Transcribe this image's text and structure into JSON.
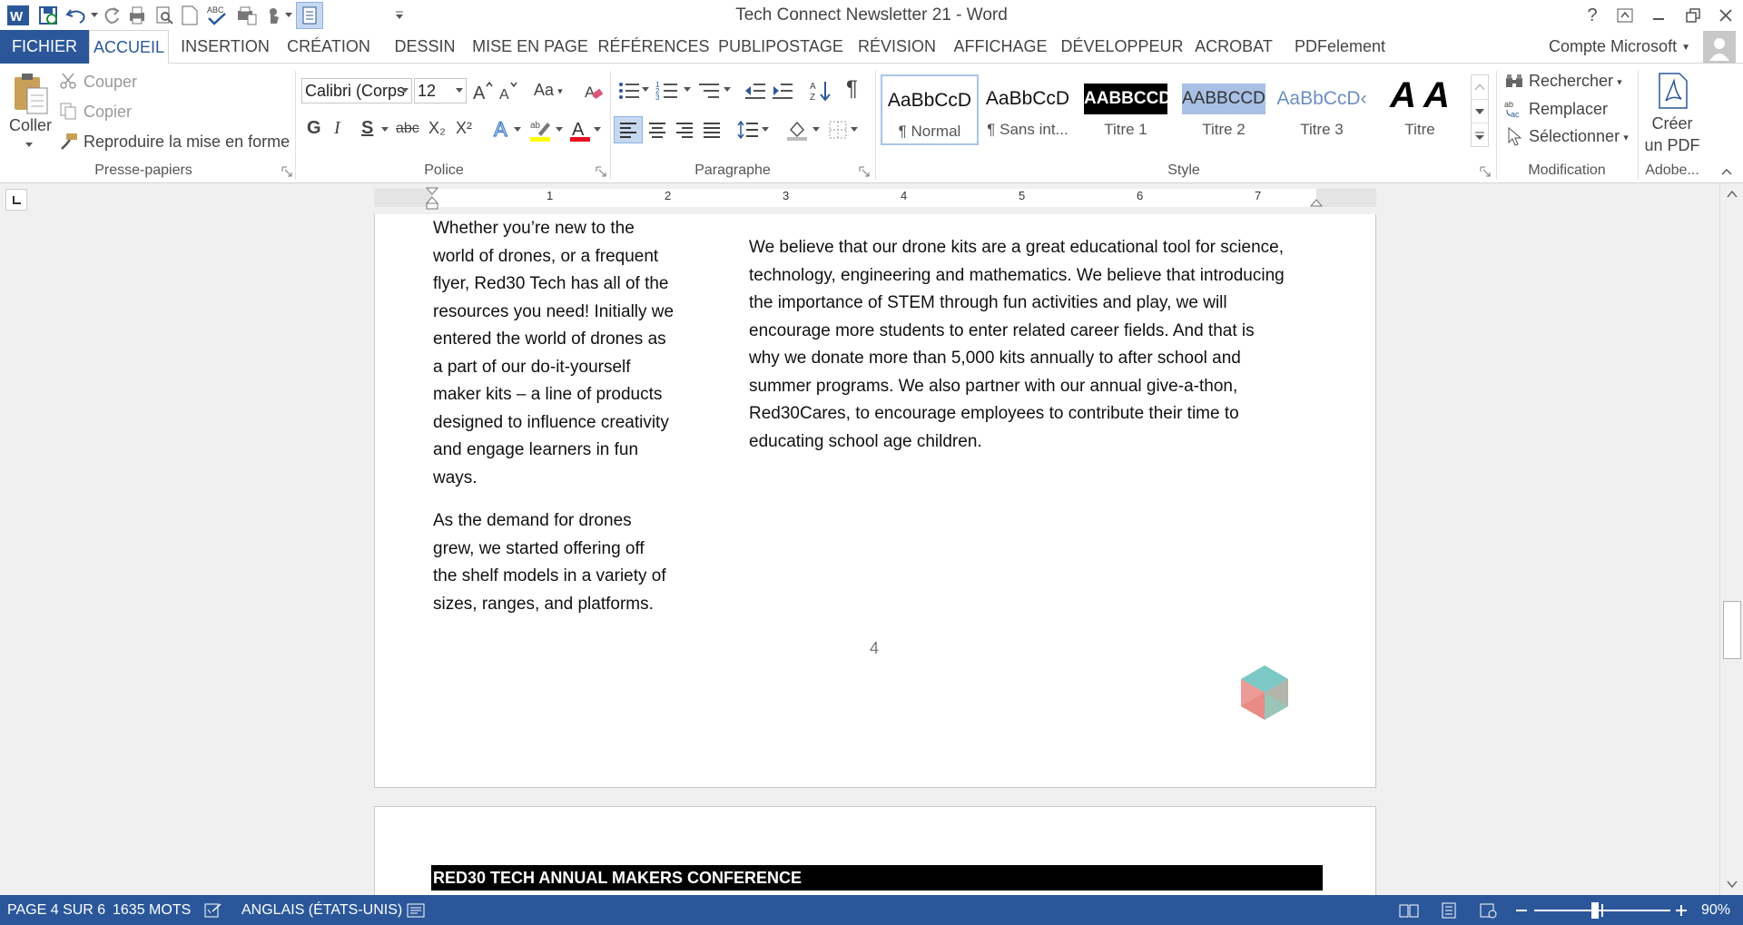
{
  "window": {
    "title": "Tech Connect Newsletter 21 - Word",
    "help": "?"
  },
  "menu": {
    "file": "FICHIER",
    "tabs": [
      "ACCUEIL",
      "INSERTION",
      "CRÉATION",
      "DESSIN",
      "MISE EN PAGE",
      "RÉFÉRENCES",
      "PUBLIPOSTAGE",
      "RÉVISION",
      "AFFICHAGE",
      "DÉVELOPPEUR",
      "ACROBAT",
      "PDFelement"
    ],
    "account": "Compte Microsoft"
  },
  "clipboard": {
    "paste": "Coller",
    "cut": "Couper",
    "copy": "Copier",
    "format_painter": "Reproduire la mise en forme",
    "label": "Presse-papiers"
  },
  "font": {
    "name": "Calibri (Corps",
    "size": "12",
    "label": "Police",
    "case": "Aa",
    "bold": "G",
    "italic": "I",
    "underline": "S",
    "strike": "abc",
    "sub": "X₂",
    "sup": "X²",
    "highlight_color": "#ffff00",
    "font_color": "#e81123"
  },
  "paragraph": {
    "label": "Paragraphe",
    "pilcrow": "¶"
  },
  "styles": {
    "label": "Style",
    "items": [
      {
        "preview": "AaBbCcD",
        "name": "¶ Normal",
        "selected": true
      },
      {
        "preview": "AaBbCcD",
        "name": "¶ Sans int..."
      },
      {
        "preview": "AABBCCDI",
        "name": "Titre 1"
      },
      {
        "preview": "AABBCCDI",
        "name": "Titre 2"
      },
      {
        "preview": "AaBbCcD‹",
        "name": "Titre 3"
      },
      {
        "preview": "A A",
        "name": "Titre"
      }
    ]
  },
  "editing": {
    "find": "Rechercher",
    "replace": "Remplacer",
    "select": "Sélectionner",
    "label": "Modification"
  },
  "adobe": {
    "create_pdf_line1": "Créer",
    "create_pdf_line2": "un PDF",
    "label": "Adobe..."
  },
  "ruler": {
    "numbers": [
      "1",
      "2",
      "3",
      "4",
      "5",
      "6",
      "7"
    ]
  },
  "document": {
    "left_col_p1": [
      "Whether you’re new to the",
      "world of drones, or a frequent",
      "flyer, Red30 Tech has all of the",
      "resources you need! Initially we",
      "entered the world of drones as",
      "a part of our do-it-yourself",
      "maker kits – a line of products",
      "designed to influence creativity",
      "and engage learners in fun",
      "ways."
    ],
    "left_col_p2": [
      "As the demand for drones",
      "grew, we started offering off",
      "the shelf models in a variety of",
      "sizes, ranges, and platforms."
    ],
    "right_col": [
      "We believe that our drone kits are a great educational tool for science,",
      "technology, engineering and mathematics. We believe that introducing",
      "the importance of STEM through fun activities and play, we will",
      "encourage more students to enter related career fields.  And that is",
      "why we donate more than 5,000 kits annually to after school and",
      "summer programs. We also partner with our annual give-a-thon,",
      "Red30Cares, to encourage employees to contribute their time to",
      "educating school age children."
    ],
    "page_number": "4",
    "next_heading": "RED30 TECH ANNUAL MAKERS CONFERENCE"
  },
  "status": {
    "page": "PAGE 4 SUR 6",
    "words": "1635 MOTS",
    "language": "ANGLAIS (ÉTATS-UNIS)",
    "zoom": "90%",
    "zoom_level_pct": 90
  }
}
